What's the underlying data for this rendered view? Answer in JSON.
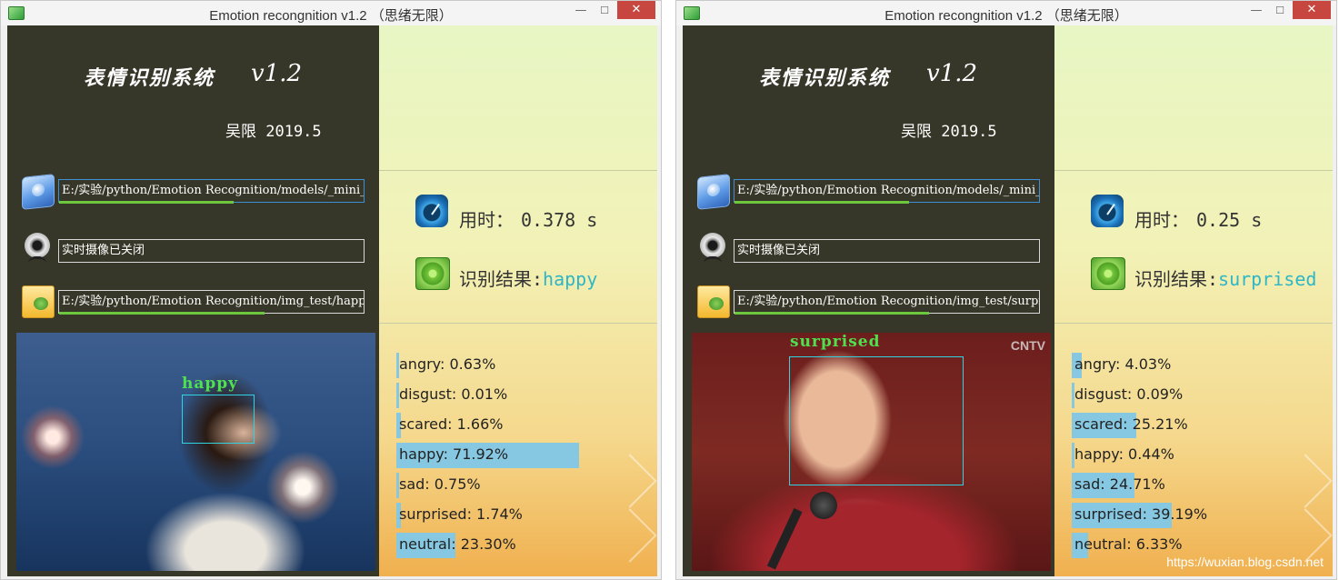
{
  "windows": [
    {
      "title": "Emotion recongnition v1.2 （思绪无限）",
      "system_title": "表情识别系统",
      "version": "v1.2",
      "author": "吴限 2019.5",
      "model_path": "E:/实验/python/Emotion Recognition/models/_mini_XCEPTION",
      "camera_status": "实时摄像已关闭",
      "image_path": "E:/实验/python/Emotion Recognition/img_test/happy",
      "model_progress": 0.57,
      "image_progress": 0.67,
      "time_label": "用时：",
      "time_value": "0.378 s",
      "result_label": "识别结果:",
      "result_value": "happy",
      "face_label": "happy",
      "emotions": [
        {
          "label": "angry: 0.63%",
          "value": 0.63
        },
        {
          "label": "disgust: 0.01%",
          "value": 0.01
        },
        {
          "label": "scared: 1.66%",
          "value": 1.66
        },
        {
          "label": "happy: 71.92%",
          "value": 71.92
        },
        {
          "label": "sad: 0.75%",
          "value": 0.75
        },
        {
          "label": "surprised: 1.74%",
          "value": 1.74
        },
        {
          "label": "neutral: 23.30%",
          "value": 23.3
        }
      ]
    },
    {
      "title": "Emotion recongnition v1.2 （思绪无限）",
      "system_title": "表情识别系统",
      "version": "v1.2",
      "author": "吴限 2019.5",
      "model_path": "E:/实验/python/Emotion Recognition/models/_mini_XCEPTION",
      "camera_status": "实时摄像已关闭",
      "image_path": "E:/实验/python/Emotion Recognition/img_test/surprised",
      "model_progress": 0.57,
      "image_progress": 0.64,
      "time_label": "用时：",
      "time_value": "0.25 s",
      "result_label": "识别结果:",
      "result_value": "surprised",
      "face_label": "surprised",
      "photo_watermark": "CNTV",
      "emotions": [
        {
          "label": "angry: 4.03%",
          "value": 4.03
        },
        {
          "label": "disgust: 0.09%",
          "value": 0.09
        },
        {
          "label": "scared: 25.21%",
          "value": 25.21
        },
        {
          "label": "happy: 0.44%",
          "value": 0.44
        },
        {
          "label": "sad: 24.71%",
          "value": 24.71
        },
        {
          "label": "surprised: 39.19%",
          "value": 39.19
        },
        {
          "label": "neutral: 6.33%",
          "value": 6.33
        }
      ]
    }
  ],
  "window_controls": {
    "minimize": "—",
    "maximize": "☐",
    "close": "✕"
  },
  "site_watermark": "https://wuxian.blog.csdn.net",
  "colors": {
    "left_panel": "#373729",
    "bar": "#86c7e2",
    "result_text": "#2fb6c6",
    "progress": "#6cc73d",
    "close_button": "#c7463f"
  },
  "icons": [
    "folder-model-icon",
    "webcam-icon",
    "folder-image-icon",
    "gauge-icon",
    "radar-icon",
    "app-icon"
  ]
}
